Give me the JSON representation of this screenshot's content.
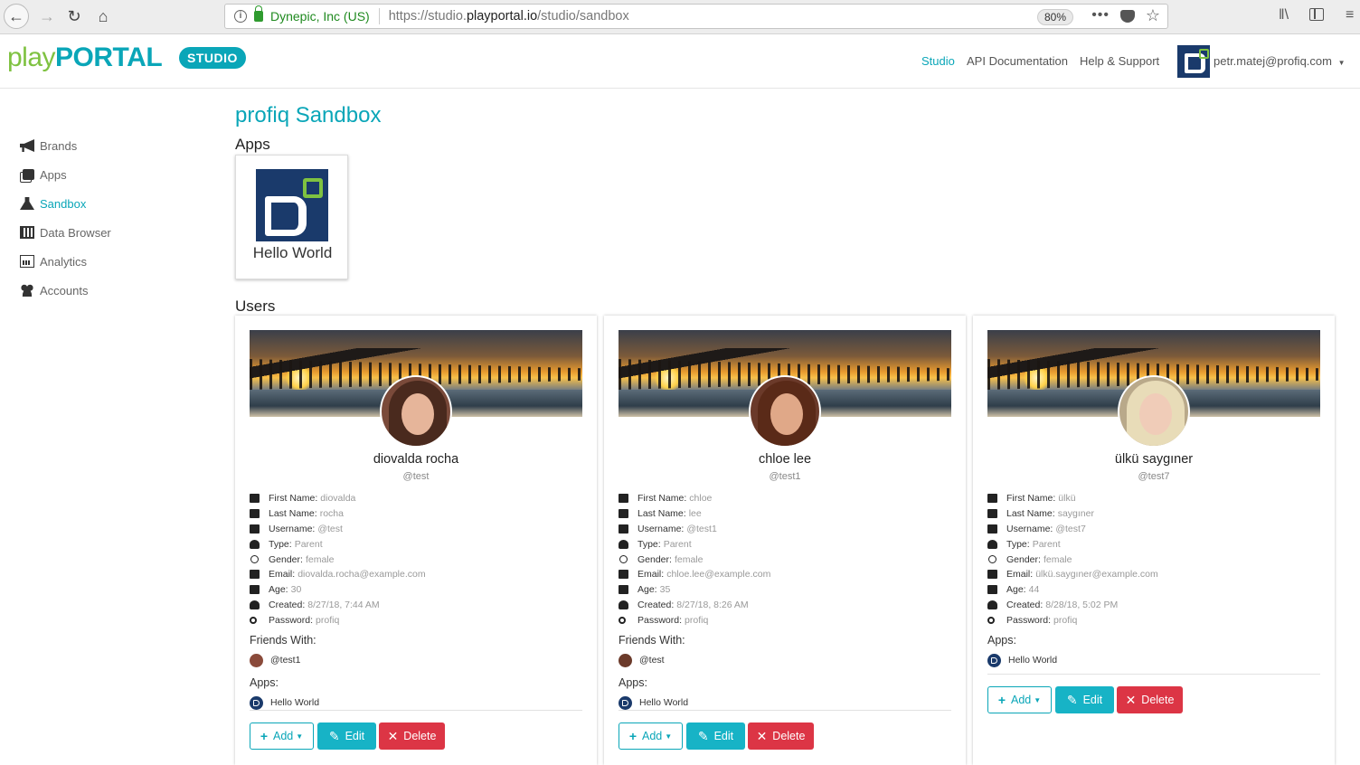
{
  "browser": {
    "org": "Dynepic, Inc (US)",
    "url_prefix": "https://studio.",
    "url_domain": "playportal.io",
    "url_path": "/studio/sandbox",
    "zoom": "80%"
  },
  "header": {
    "logo_play": "play",
    "logo_portal": "PORTAL",
    "badge": "STUDIO",
    "nav": {
      "studio": "Studio",
      "api_docs": "API Documentation",
      "help": "Help & Support"
    },
    "user_email": "petr.matej@profiq.com"
  },
  "sidebar": {
    "items": [
      {
        "label": "Brands"
      },
      {
        "label": "Apps"
      },
      {
        "label": "Sandbox"
      },
      {
        "label": "Data Browser"
      },
      {
        "label": "Analytics"
      },
      {
        "label": "Accounts"
      }
    ]
  },
  "main": {
    "title": "profiq Sandbox",
    "apps_heading": "Apps",
    "apps": [
      {
        "name": "Hello World"
      }
    ],
    "users_heading": "Users"
  },
  "labels": {
    "first_name": "First Name:",
    "last_name": "Last Name:",
    "username": "Username:",
    "type": "Type:",
    "gender": "Gender:",
    "email": "Email:",
    "age": "Age:",
    "created": "Created:",
    "password": "Password:",
    "friends_with": "Friends With:",
    "apps": "Apps:",
    "add": "Add",
    "edit": "Edit",
    "delete": "Delete"
  },
  "users": [
    {
      "name": "diovalda rocha",
      "handle": "@test",
      "first_name": "diovalda",
      "last_name": "rocha",
      "username": "@test",
      "type": "Parent",
      "gender": "female",
      "email": "diovalda.rocha@example.com",
      "age": "30",
      "created": "8/27/18, 7:44 AM",
      "password": "profiq",
      "friend": "@test1",
      "app": "Hello World"
    },
    {
      "name": "chloe lee",
      "handle": "@test1",
      "first_name": "chloe",
      "last_name": "lee",
      "username": "@test1",
      "type": "Parent",
      "gender": "female",
      "email": "chloe.lee@example.com",
      "age": "35",
      "created": "8/27/18, 8:26 AM",
      "password": "profiq",
      "friend": "@test",
      "app": "Hello World"
    },
    {
      "name": "ülkü saygıner",
      "handle": "@test7",
      "first_name": "ülkü",
      "last_name": "saygıner",
      "username": "@test7",
      "type": "Parent",
      "gender": "female",
      "email": "ülkü.saygıner@example.com",
      "age": "44",
      "created": "8/28/18, 5:02 PM",
      "password": "profiq",
      "app": "Hello World"
    }
  ],
  "colors": {
    "brand_teal": "#0aa6b8",
    "brand_green": "#7fc241",
    "navy": "#1a3a6b",
    "danger": "#dc3545"
  }
}
